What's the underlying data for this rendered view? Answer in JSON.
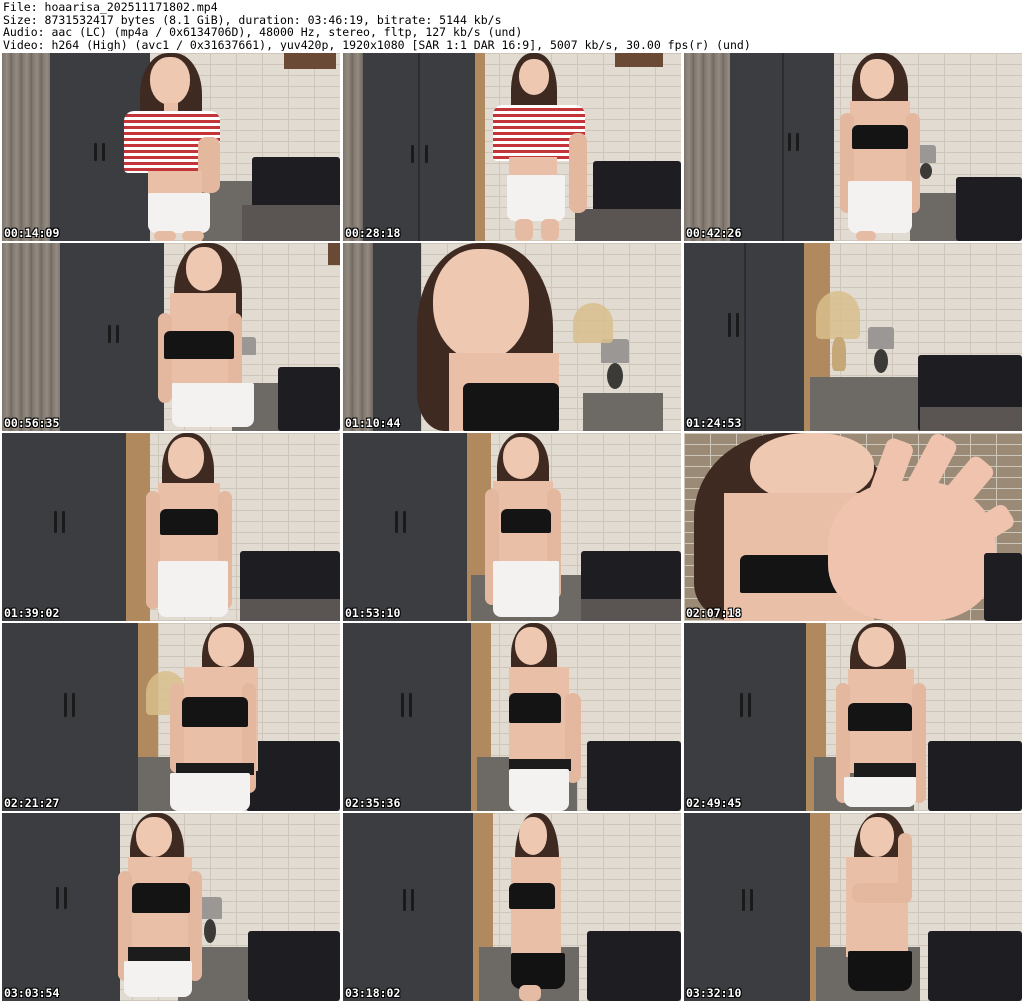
{
  "header": {
    "file_line": "File: hoaarisa_202511171802.mp4",
    "size_line": "Size: 8731532417 bytes (8.1 GiB), duration: 03:46:19, bitrate: 5144 kb/s",
    "audio_line": "Audio: aac (LC) (mp4a / 0x6134706D), 48000 Hz, stereo, fltp, 127 kb/s (und)",
    "video_line": "Video: h264 (High) (avc1 / 0x31637661), yuv420p, 1920x1080 [SAR 1:1 DAR 16:9], 5007 kb/s, 30.00 fps(r) (und)"
  },
  "thumbnails": [
    {
      "timestamp": "00:14:09"
    },
    {
      "timestamp": "00:28:18"
    },
    {
      "timestamp": "00:42:26"
    },
    {
      "timestamp": "00:56:35"
    },
    {
      "timestamp": "01:10:44"
    },
    {
      "timestamp": "01:24:53"
    },
    {
      "timestamp": "01:39:02"
    },
    {
      "timestamp": "01:53:10"
    },
    {
      "timestamp": "02:07:18"
    },
    {
      "timestamp": "02:21:27"
    },
    {
      "timestamp": "02:35:36"
    },
    {
      "timestamp": "02:49:45"
    },
    {
      "timestamp": "03:03:54"
    },
    {
      "timestamp": "03:18:02"
    },
    {
      "timestamp": "03:32:10"
    }
  ]
}
